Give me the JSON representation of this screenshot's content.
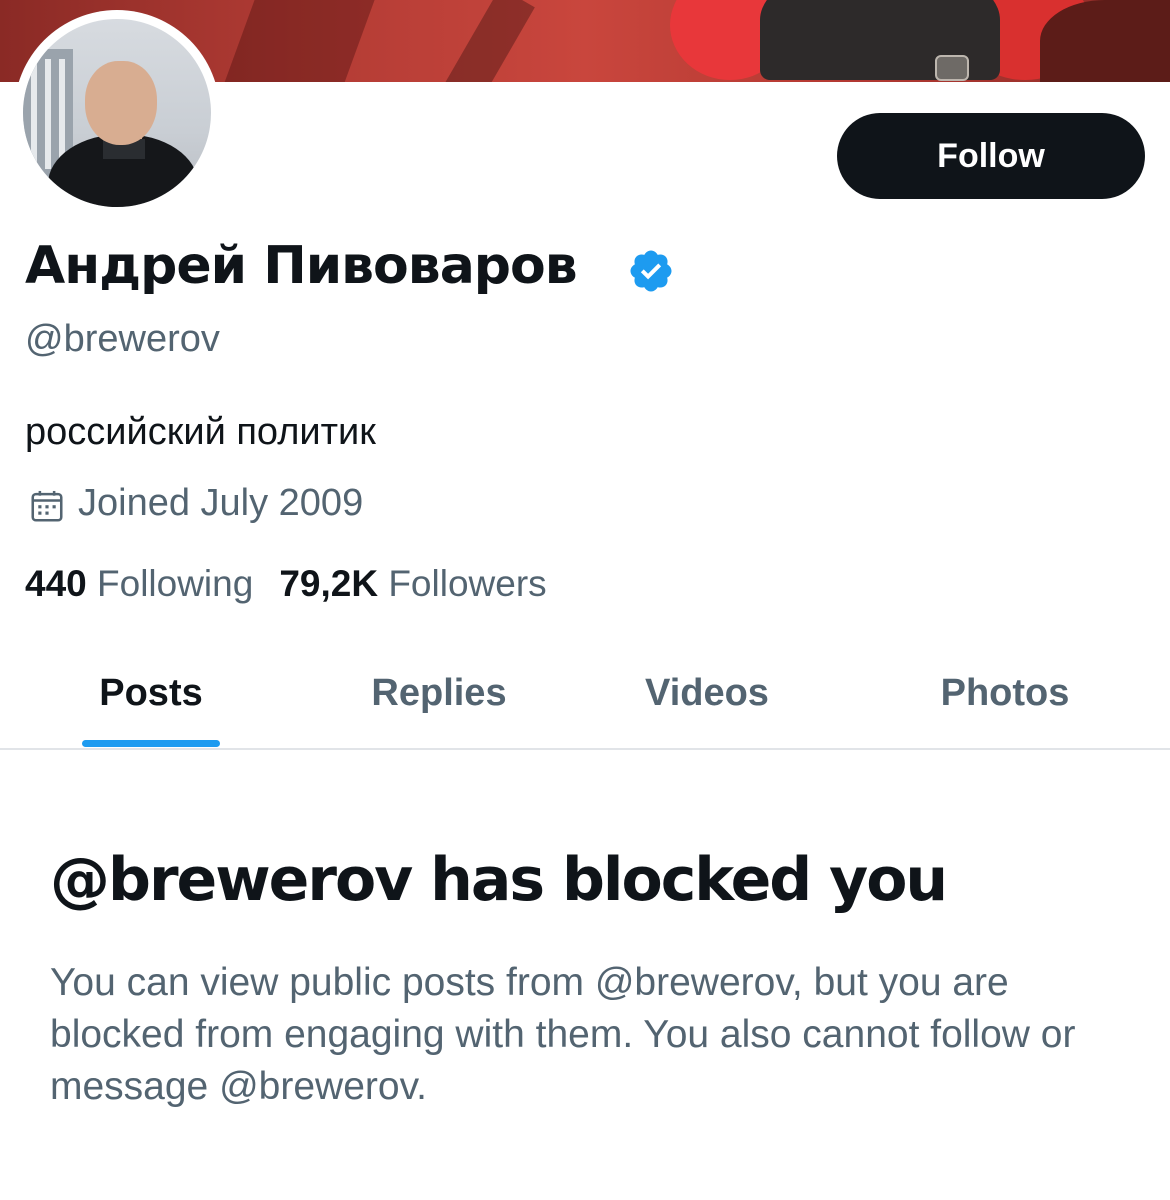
{
  "profile": {
    "display_name": "Андрей Пивоваров",
    "handle": "@brewerov",
    "bio": "российский политик",
    "joined": "Joined July 2009",
    "verified": true,
    "verified_color": "#1d9bf0"
  },
  "actions": {
    "follow_label": "Follow"
  },
  "stats": {
    "following_count": "440",
    "following_label": "Following",
    "followers_count": "79,2K",
    "followers_label": "Followers"
  },
  "tabs": [
    {
      "label": "Posts",
      "active": true
    },
    {
      "label": "Replies",
      "active": false
    },
    {
      "label": "Videos",
      "active": false
    },
    {
      "label": "Photos",
      "active": false
    }
  ],
  "blocked_notice": {
    "title": "@brewerov has blocked you",
    "message": "You can view public posts from @brewerov, but you are blocked from engaging with them. You also cannot follow or message @brewerov."
  },
  "icons": {
    "verified": "verified-badge-icon",
    "calendar": "calendar-icon"
  },
  "colors": {
    "accent": "#1d9bf0",
    "text_primary": "#0f1419",
    "text_secondary": "#536471",
    "button_bg": "#0f1419"
  }
}
